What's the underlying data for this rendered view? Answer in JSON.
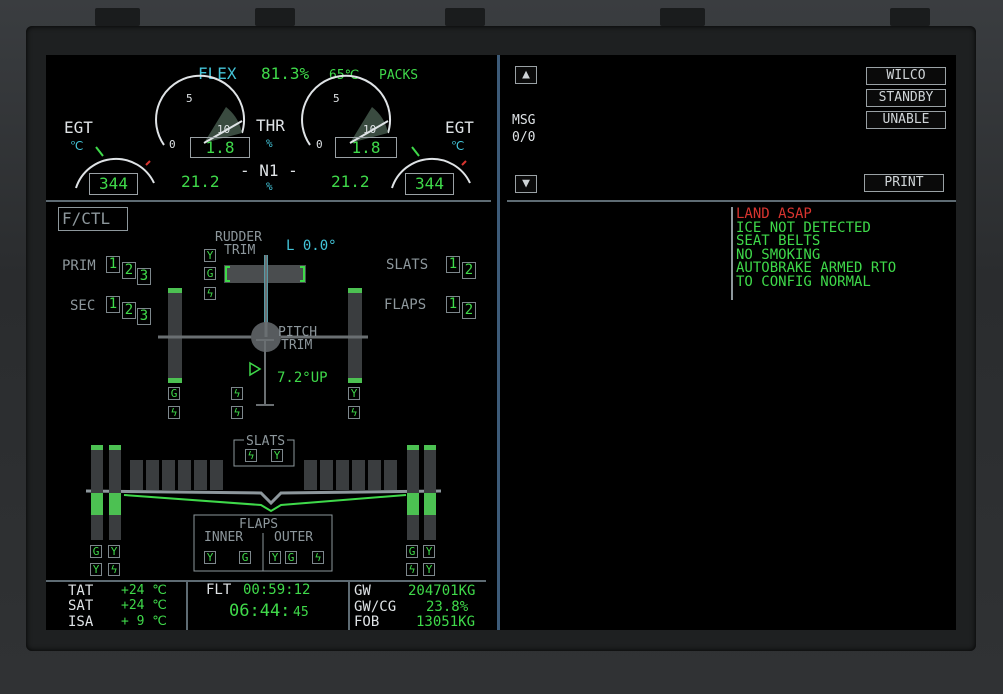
{
  "engine": {
    "thrust_mode": "FLEX",
    "thrust_pct": "81.3%",
    "flex_temp": "65℃",
    "packs": "PACKS",
    "egt_label": "EGT",
    "egt_unit": "℃",
    "egt_left": "344",
    "egt_right": "344",
    "thr_label": "THR",
    "thr_unit": "%",
    "thr_left": "1.8",
    "thr_right": "1.8",
    "n1_label": "- N1 -",
    "n1_unit": "%",
    "n1_left": "21.2",
    "n1_right": "21.2",
    "gauge_5": "5",
    "gauge_10": "10",
    "gauge_0": "0"
  },
  "fctl": {
    "title": "F/CTL",
    "rudder_trim": "RUDDER",
    "rudder_trim2": "TRIM",
    "rudder_value": "L 0.0°",
    "prim_label": "PRIM",
    "sec_label": "SEC",
    "prim_nums": [
      "1",
      "2",
      "3"
    ],
    "sec_nums": [
      "1",
      "2",
      "3"
    ],
    "slats_label": "SLATS",
    "flaps_label": "FLAPS",
    "slats_nums": [
      "1",
      "2"
    ],
    "flaps_nums": [
      "1",
      "2"
    ],
    "pitch_trim": "PITCH",
    "pitch_trim2": "TRIM",
    "pitch_value": "7.2°UP",
    "hyd_g": "G",
    "hyd_y": "Y",
    "hyd_elec": "ϟ",
    "slats_bottom": "SLATS",
    "flaps_bottom": "FLAPS",
    "inner": "INNER",
    "outer": "OUTER"
  },
  "status": {
    "tat_label": "TAT",
    "tat_value": "+24 ℃",
    "sat_label": "SAT",
    "sat_value": "+24 ℃",
    "isa_label": "ISA",
    "isa_value": "+ 9 ℃",
    "flt_label": "FLT",
    "flt_value": "00:59:12",
    "utc_value": "06:44:",
    "utc_sec": "45",
    "gw_label": "GW",
    "gw_value": "204701KG",
    "gwcg_label": "GW/CG",
    "gwcg_value": "23.8%",
    "fob_label": "FOB",
    "fob_value": "13051KG"
  },
  "datalink": {
    "msg_label": "MSG",
    "msg_count": "0/0",
    "wilco": "WILCO",
    "standby": "STANDBY",
    "unable": "UNABLE",
    "print": "PRINT"
  },
  "memo": {
    "red": [
      "LAND ASAP"
    ],
    "green": [
      "ICE NOT DETECTED",
      "SEAT BELTS",
      "NO SMOKING",
      "AUTOBRAKE ARMED RTO",
      "TO CONFIG NORMAL"
    ]
  },
  "colors": {
    "green": "#3fd94a",
    "cyan": "#43c4d8",
    "amber_red": "#d8342f",
    "white": "#dfe3e6"
  }
}
